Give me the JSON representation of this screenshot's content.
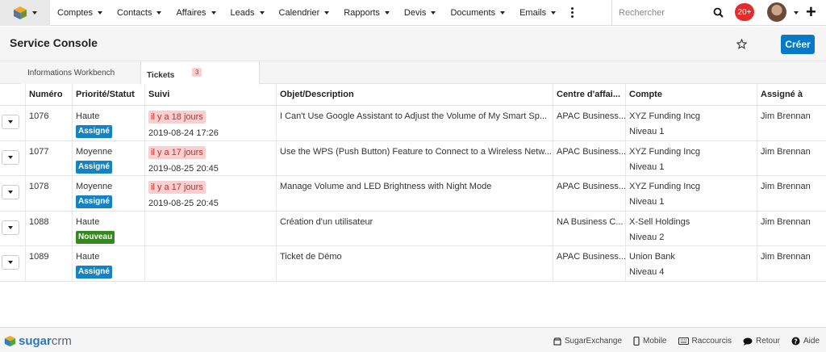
{
  "nav": {
    "items": [
      {
        "label": "Comptes"
      },
      {
        "label": "Contacts"
      },
      {
        "label": "Affaires"
      },
      {
        "label": "Leads"
      },
      {
        "label": "Calendrier"
      },
      {
        "label": "Rapports"
      },
      {
        "label": "Devis"
      },
      {
        "label": "Documents"
      },
      {
        "label": "Emails"
      }
    ],
    "search_placeholder": "Rechercher",
    "notification_count": "20+"
  },
  "header": {
    "title": "Service Console",
    "create_label": "Créer"
  },
  "tabs": [
    {
      "label": "Informations Workbench"
    },
    {
      "label": "Tickets",
      "count": "3"
    }
  ],
  "table": {
    "columns": [
      "Numéro",
      "Priorité/Statut",
      "Suivi",
      "Objet/Description",
      "Centre d'affai...",
      "Compte",
      "Assigné à"
    ],
    "rows": [
      {
        "num": "1076",
        "priority": "Haute",
        "status": "Assigné",
        "late": "il y a 18 jours",
        "date": "2019-08-24 17:26",
        "subject": "I Can't Use Google Assistant to Adjust the Volume of My Smart Sp...",
        "center": "APAC Business...",
        "account": "XYZ Funding Incg",
        "level": "Niveau 1",
        "assigned": "Jim Brennan"
      },
      {
        "num": "1077",
        "priority": "Moyenne",
        "status": "Assigné",
        "late": "il y a 17 jours",
        "date": "2019-08-25 20:45",
        "subject": "Use the WPS (Push Button) Feature to Connect to a Wireless Netw...",
        "center": "APAC Business...",
        "account": "XYZ Funding Incg",
        "level": "Niveau 1",
        "assigned": "Jim Brennan"
      },
      {
        "num": "1078",
        "priority": "Moyenne",
        "status": "Assigné",
        "late": "il y a 17 jours",
        "date": "2019-08-25 20:45",
        "subject": "Manage Volume and LED Brightness with Night Mode",
        "center": "APAC Business...",
        "account": "XYZ Funding Incg",
        "level": "Niveau 1",
        "assigned": "Jim Brennan"
      },
      {
        "num": "1088",
        "priority": "Haute",
        "status": "Nouveau",
        "late": "",
        "date": "",
        "subject": "Création d'un utilisateur",
        "center": "NA Business C...",
        "account": "X-Sell Holdings",
        "level": "Niveau 2",
        "assigned": "Jim Brennan"
      },
      {
        "num": "1089",
        "priority": "Haute",
        "status": "Assigné",
        "late": "",
        "date": "",
        "subject": "Ticket de Démo",
        "center": "APAC Business...",
        "account": "Union Bank",
        "level": "Niveau 4",
        "assigned": "Jim Brennan"
      }
    ]
  },
  "footer": {
    "brand_a": "sugar",
    "brand_b": "crm",
    "links": [
      {
        "label": "SugarExchange",
        "icon": "store-icon"
      },
      {
        "label": "Mobile",
        "icon": "mobile-icon"
      },
      {
        "label": "Raccourcis",
        "icon": "keyboard-icon"
      },
      {
        "label": "Retour",
        "icon": "chat-icon"
      },
      {
        "label": "Aide",
        "icon": "help-icon"
      }
    ]
  },
  "colors": {
    "accent": "#0679c8",
    "badge_assigned": "#1483c6",
    "badge_new": "#35881e",
    "late_bg": "#f8d0d0",
    "late_text": "#cc2b2b",
    "notification": "#e52c2c"
  }
}
